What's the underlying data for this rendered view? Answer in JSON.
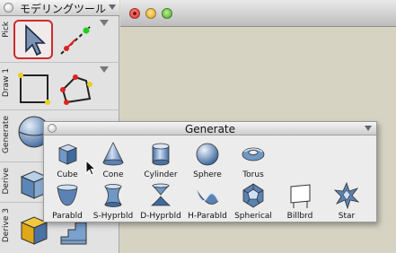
{
  "palette": {
    "title": "モデリングツール",
    "groups": [
      {
        "label": "Pick"
      },
      {
        "label": "Draw 1"
      },
      {
        "label": "Generate"
      },
      {
        "label": "Derive"
      },
      {
        "label": "Derive 3"
      }
    ]
  },
  "generate": {
    "title": "Generate",
    "shapes": [
      {
        "label": "Cube",
        "icon": "cube-icon"
      },
      {
        "label": "Cone",
        "icon": "cone-icon"
      },
      {
        "label": "Cylinder",
        "icon": "cylinder-icon"
      },
      {
        "label": "Sphere",
        "icon": "sphere-icon"
      },
      {
        "label": "Torus",
        "icon": "torus-icon"
      },
      {
        "label": "Parabld",
        "icon": "paraboloid-icon"
      },
      {
        "label": "S-Hyprbld",
        "icon": "single-hyperboloid-icon"
      },
      {
        "label": "D-Hyprbld",
        "icon": "double-hyperboloid-icon"
      },
      {
        "label": "H-Parabld",
        "icon": "hyperbolic-paraboloid-icon"
      },
      {
        "label": "Spherical",
        "icon": "spherical-polyhedron-icon"
      },
      {
        "label": "Billbrd",
        "icon": "billboard-icon"
      },
      {
        "label": "Star",
        "icon": "star-icon"
      }
    ]
  },
  "colors": {
    "background": "#d6d3c3",
    "selection_border": "#d02a2a",
    "shape_blue": "#6f9fd0"
  }
}
